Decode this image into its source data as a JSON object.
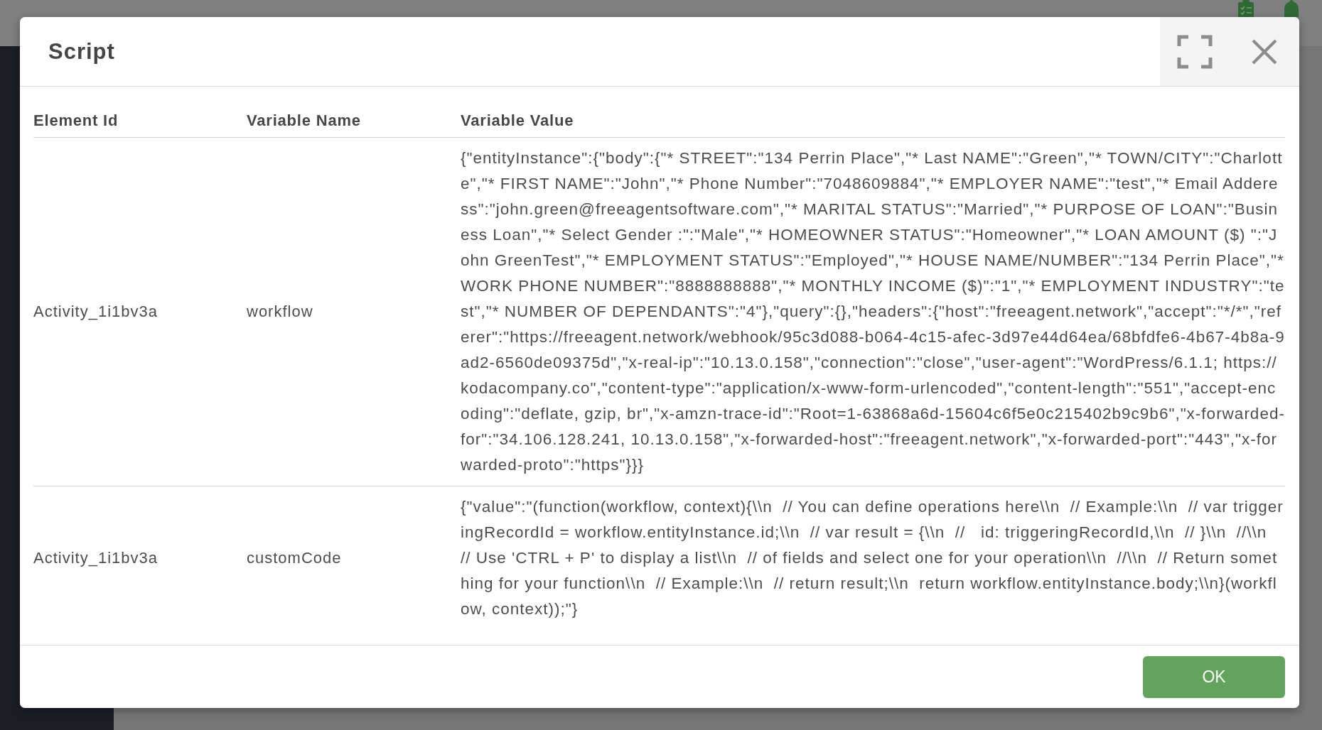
{
  "dialog": {
    "title": "Script",
    "table": {
      "columns": [
        "Element Id",
        "Variable Name",
        "Variable Value"
      ],
      "rows": [
        {
          "element_id": "Activity_1i1bv3a",
          "variable_name": "workflow",
          "variable_value": "{\"entityInstance\":{\"body\":{\"* STREET\":\"134 Perrin Place\",\"* Last NAME\":\"Green\",\"* TOWN/CITY\":\"Charlotte\",\"* FIRST NAME\":\"John\",\"* Phone Number\":\"7048609884\",\"* EMPLOYER NAME\":\"test\",\"* Email Adderess\":\"john.green@freeagentsoftware.com\",\"* MARITAL STATUS\":\"Married\",\"* PURPOSE OF LOAN\":\"Business Loan\",\"* Select Gender :\":\"Male\",\"* HOMEOWNER STATUS\":\"Homeowner\",\"* LOAN AMOUNT ($) \":\"John GreenTest\",\"* EMPLOYMENT STATUS\":\"Employed\",\"* HOUSE NAME/NUMBER\":\"134 Perrin Place\",\"* WORK PHONE NUMBER\":\"8888888888\",\"* MONTHLY INCOME ($)\":\"1\",\"* EMPLOYMENT INDUSTRY\":\"test\",\"* NUMBER OF DEPENDANTS\":\"4\"},\"query\":{},\"headers\":{\"host\":\"freeagent.network\",\"accept\":\"*/*\",\"referer\":\"https://freeagent.network/webhook/95c3d088-b064-4c15-afec-3d97e44d64ea/68bfdfe6-4b67-4b8a-9ad2-6560de09375d\",\"x-real-ip\":\"10.13.0.158\",\"connection\":\"close\",\"user-agent\":\"WordPress/6.1.1; https://kodacompany.co\",\"content-type\":\"application/x-www-form-urlencoded\",\"content-length\":\"551\",\"accept-encoding\":\"deflate, gzip, br\",\"x-amzn-trace-id\":\"Root=1-63868a6d-15604c6f5e0c215402b9c9b6\",\"x-forwarded-for\":\"34.106.128.241, 10.13.0.158\",\"x-forwarded-host\":\"freeagent.network\",\"x-forwarded-port\":\"443\",\"x-forwarded-proto\":\"https\"}}}"
        },
        {
          "element_id": "Activity_1i1bv3a",
          "variable_name": "customCode",
          "variable_value": "{\"value\":\"(function(workflow, context){\\\\n  // You can define operations here\\\\n  // Example:\\\\n  // var triggeringRecordId = workflow.entityInstance.id;\\\\n  // var result = {\\\\n  //   id: triggeringRecordId,\\\\n  // }\\\\n  //\\\\n  // Use 'CTRL + P' to display a list\\\\n  // of fields and select one for your operation\\\\n  //\\\\n  // Return something for your function\\\\n  // Example:\\\\n  // return result;\\\\n  return workflow.entityInstance.body;\\\\n}(workflow, context));\"}"
        }
      ]
    },
    "footer_buttons": [
      "OK"
    ]
  }
}
